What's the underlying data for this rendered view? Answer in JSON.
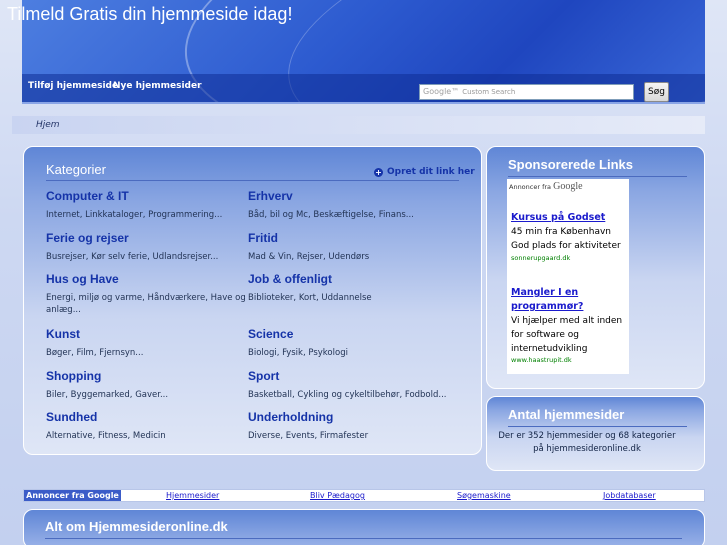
{
  "header": {
    "title": "Tilmeld Gratis din hjemmeside idag!",
    "nav": [
      "Tilføj hjemmeside",
      "Nye hjemmesider"
    ],
    "search": {
      "placeholder": "Custom Search",
      "logo": "Google™",
      "button": "Søg"
    }
  },
  "breadcrumb": "Hjem",
  "categories": {
    "title": "Kategorier",
    "add_link": "Opret dit link her",
    "items": [
      {
        "name": "Computer & IT",
        "sub": "Internet, Linkkataloger, Programmering..."
      },
      {
        "name": "Erhverv",
        "sub": "Båd, bil og Mc, Beskæftigelse, Finans..."
      },
      {
        "name": "Ferie og rejser",
        "sub": "Busrejser, Kør selv ferie, Udlandsrejser..."
      },
      {
        "name": "Fritid",
        "sub": "Mad & Vin, Rejser, Udendørs"
      },
      {
        "name": "Hus og Have",
        "sub": "Energi, miljø og varme, Håndværkere, Have og anlæg..."
      },
      {
        "name": "Job & offenligt",
        "sub": "Biblioteker, Kort, Uddannelse"
      },
      {
        "name": "Kunst",
        "sub": "Bøger, Film, Fjernsyn..."
      },
      {
        "name": "Science",
        "sub": "Biologi, Fysik, Psykologi"
      },
      {
        "name": "Shopping",
        "sub": "Biler, Byggemarked, Gaver..."
      },
      {
        "name": "Sport",
        "sub": "Basketball, Cykling og cykeltilbehør, Fodbold..."
      },
      {
        "name": "Sundhed",
        "sub": "Alternative, Fitness, Medicin"
      },
      {
        "name": "Underholdning",
        "sub": "Diverse, Events, Firmafester"
      }
    ]
  },
  "sponsored": {
    "title": "Sponsorerede Links",
    "label_prefix": "Annoncer fra",
    "label_brand": "Google",
    "ads": [
      {
        "title": "Kursus på Godset",
        "lines": [
          "45 min fra København",
          "God plads for aktiviteter"
        ],
        "url": "sonnerupgaard.dk"
      },
      {
        "title_lines": [
          "Mangler I en",
          "programmør?"
        ],
        "lines": [
          "Vi hjælper med alt inden",
          "for software og",
          "internetudvikling"
        ],
        "url": "www.haastrupit.dk"
      }
    ]
  },
  "count": {
    "title": "Antal hjemmesider",
    "lines": [
      "Der er 352 hjemmesider og 68 kategorier",
      "på hjemmesideronline.dk"
    ]
  },
  "linkbar": {
    "ad_label": "Annoncer fra Google",
    "links": [
      "Hjemmesider",
      "Bliv Pædagog",
      "Søgemaskine",
      "Jobdatabaser"
    ]
  },
  "about": {
    "title": "Alt om Hjemmesideronline.dk"
  }
}
